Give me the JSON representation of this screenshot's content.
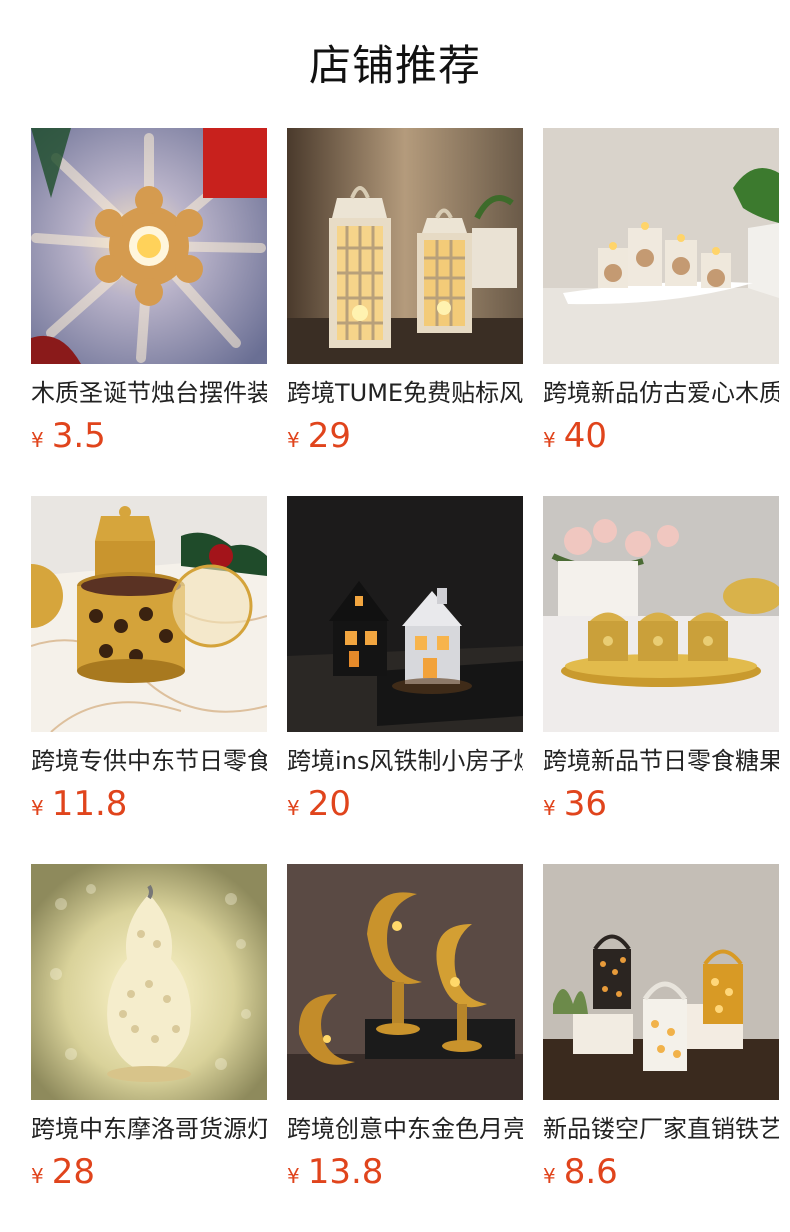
{
  "section": {
    "title": "店铺推荐"
  },
  "currency_symbol": "¥",
  "products": [
    {
      "name": "木质圣诞节烛台摆件装饰",
      "price": "3.5",
      "image": "wooden-snowflake-candle-holder"
    },
    {
      "name": "跨境TUME免费贴标风灯",
      "price": "29",
      "image": "white-metal-lanterns"
    },
    {
      "name": "跨境新品仿古爱心木质烛台",
      "price": "40",
      "image": "home-letter-candles"
    },
    {
      "name": "跨境专供中东节日零食糖果罐",
      "price": "11.8",
      "image": "gold-candy-jars"
    },
    {
      "name": "跨境ins风铁制小房子烛台",
      "price": "20",
      "image": "metal-house-lanterns"
    },
    {
      "name": "跨境新品节日零食糖果罐托盘",
      "price": "36",
      "image": "gold-jar-tray-set"
    },
    {
      "name": "跨境中东摩洛哥货源灯笼",
      "price": "28",
      "image": "gourd-hollow-lamp"
    },
    {
      "name": "跨境创意中东金色月亮烛台",
      "price": "13.8",
      "image": "gold-moon-candle-holders"
    },
    {
      "name": "新品镂空厂家直销铁艺烛台",
      "price": "8.6",
      "image": "hollow-iron-lanterns"
    }
  ]
}
